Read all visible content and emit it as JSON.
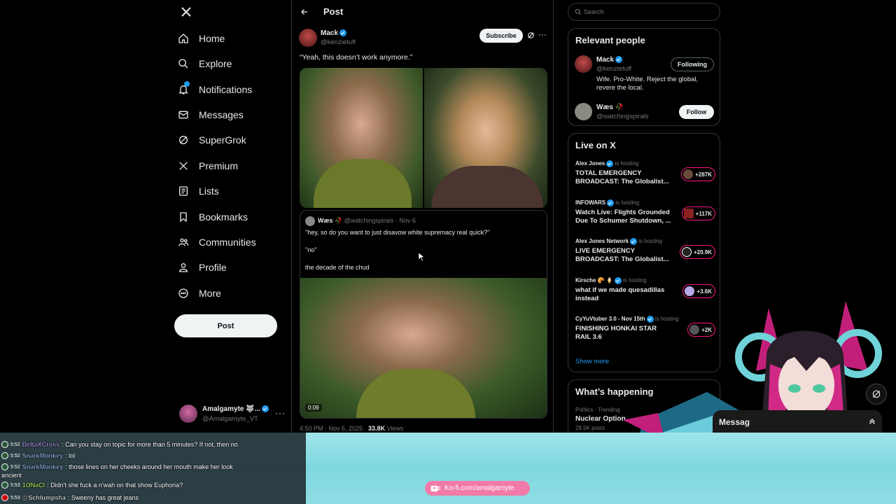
{
  "left_nav": {
    "logo": "x-logo-icon",
    "items": [
      {
        "label": "Home",
        "icon": "home-icon"
      },
      {
        "label": "Explore",
        "icon": "search-icon"
      },
      {
        "label": "Notifications",
        "icon": "bell-icon"
      },
      {
        "label": "Messages",
        "icon": "mail-icon"
      },
      {
        "label": "SuperGrok",
        "icon": "grok-icon"
      },
      {
        "label": "Premium",
        "icon": "x-premium-icon"
      },
      {
        "label": "Lists",
        "icon": "list-icon"
      },
      {
        "label": "Bookmarks",
        "icon": "bookmark-icon"
      },
      {
        "label": "Communities",
        "icon": "communities-icon"
      },
      {
        "label": "Profile",
        "icon": "profile-icon"
      },
      {
        "label": "More",
        "icon": "more-circle-icon"
      }
    ],
    "post_button": "Post",
    "account": {
      "name": "Amalgamyte 🐺...",
      "handle": "@Amalgamyte_VT"
    }
  },
  "post": {
    "header_title": "Post",
    "author_name": "Mack",
    "author_handle": "@kenzietuff",
    "subscribe_label": "Subscribe",
    "text": "“Yeah, this doesn’t work anymore.”",
    "quote": {
      "name": "Wæs 🥀",
      "handle": "@watchingspirals · Nov 6",
      "line1": "\"hey, so do you want to just disavow white supremacy real quick?\"",
      "line2": "\"no\"",
      "line3": "the decade of the chud"
    },
    "video_time": "0:09",
    "meta_time": "4:50 PM · Nov 6, 2025 · ",
    "views_count": "33.8K",
    "views_label": " Views"
  },
  "search": {
    "placeholder": "Search"
  },
  "relevant_people": {
    "title": "Relevant people",
    "people": [
      {
        "name": "Mack",
        "handle": "@kenzietuff",
        "bio": "Wife. Pro-White. Reject the global, revere the local.",
        "button": "Following"
      },
      {
        "name": "Wæs 🥀",
        "handle": "@watchingspirals",
        "button": "Follow"
      }
    ]
  },
  "live": {
    "title": "Live on X",
    "hosting_label": "is hosting",
    "items": [
      {
        "host": "Alex Jones",
        "title": "TOTAL EMERGENCY BROADCAST: The Globalist...",
        "count": "+287K"
      },
      {
        "host": "INFOWARS",
        "title": "Watch Live: Flights Grounded Due To Schumer Shutdown, ...",
        "count": "+117K"
      },
      {
        "host": "Alex Jones Network",
        "title": "LIVE EMERGENCY BROADCAST: The Globalist...",
        "count": "+20.9K"
      },
      {
        "host": "Kirsche 🥐 🍦",
        "title": "what if we made quesadillas instead",
        "count": "+3.6K"
      },
      {
        "host": "CyYuVtuber 3.0 - Nov 15th",
        "title": "FINISHING HONKAI STAR RAIL 3.6",
        "count": "+2K"
      }
    ],
    "show_more": "Show more"
  },
  "happening": {
    "title": "What’s happening",
    "category": "Politics · Trending",
    "topic": "Nuclear Option",
    "posts": "28.5K posts"
  },
  "messages_drawer": {
    "label": "Messag"
  },
  "chat": [
    {
      "user": "DeltaXCross",
      "msg": ": Can you stay on topic for more than 5 minutes? If not, then no",
      "time": "5:52",
      "color": "#b9a5ff"
    },
    {
      "user": "SnarkMonkey",
      "msg": ": lol",
      "time": "5:52",
      "color": "#a0c8ff"
    },
    {
      "user": "SnarkMonkey",
      "msg": ": those lines on her cheeks around her mouth make her look",
      "time": "5:52",
      "color": "#a0c8ff"
    },
    {
      "user": "",
      "msg": "ancient",
      "time": "",
      "color": "#ffffff"
    },
    {
      "user": "1ONaCl",
      "msg": ": Didn't she fuck a n'wah on that show Euphoria?",
      "time": "5:53",
      "color": "#c8ff6e"
    },
    {
      "user": "@Schlumpsha",
      "msg": ": Sweeny has great jeans",
      "time": "5:53",
      "color": "#ffffff"
    }
  ],
  "kofi": {
    "label": "Ko-fi.com/amalgamyte"
  },
  "colors": {
    "accent": "#1d9bf0",
    "live_pink": "#f91880",
    "chat_bg": "#8fdde4"
  }
}
